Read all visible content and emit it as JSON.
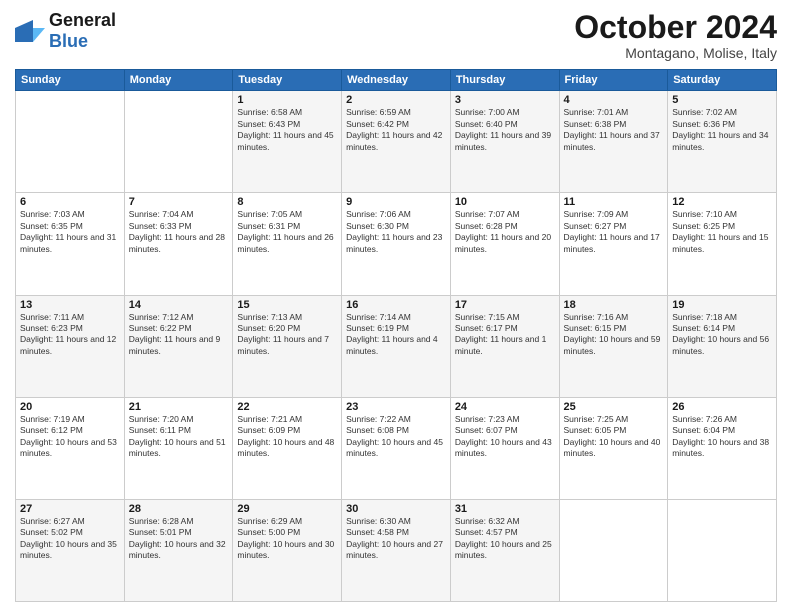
{
  "header": {
    "logo_general": "General",
    "logo_blue": "Blue",
    "month_title": "October 2024",
    "location": "Montagano, Molise, Italy"
  },
  "days_of_week": [
    "Sunday",
    "Monday",
    "Tuesday",
    "Wednesday",
    "Thursday",
    "Friday",
    "Saturday"
  ],
  "weeks": [
    [
      {
        "day": "",
        "sunrise": "",
        "sunset": "",
        "daylight": ""
      },
      {
        "day": "",
        "sunrise": "",
        "sunset": "",
        "daylight": ""
      },
      {
        "day": "1",
        "sunrise": "Sunrise: 6:58 AM",
        "sunset": "Sunset: 6:43 PM",
        "daylight": "Daylight: 11 hours and 45 minutes."
      },
      {
        "day": "2",
        "sunrise": "Sunrise: 6:59 AM",
        "sunset": "Sunset: 6:42 PM",
        "daylight": "Daylight: 11 hours and 42 minutes."
      },
      {
        "day": "3",
        "sunrise": "Sunrise: 7:00 AM",
        "sunset": "Sunset: 6:40 PM",
        "daylight": "Daylight: 11 hours and 39 minutes."
      },
      {
        "day": "4",
        "sunrise": "Sunrise: 7:01 AM",
        "sunset": "Sunset: 6:38 PM",
        "daylight": "Daylight: 11 hours and 37 minutes."
      },
      {
        "day": "5",
        "sunrise": "Sunrise: 7:02 AM",
        "sunset": "Sunset: 6:36 PM",
        "daylight": "Daylight: 11 hours and 34 minutes."
      }
    ],
    [
      {
        "day": "6",
        "sunrise": "Sunrise: 7:03 AM",
        "sunset": "Sunset: 6:35 PM",
        "daylight": "Daylight: 11 hours and 31 minutes."
      },
      {
        "day": "7",
        "sunrise": "Sunrise: 7:04 AM",
        "sunset": "Sunset: 6:33 PM",
        "daylight": "Daylight: 11 hours and 28 minutes."
      },
      {
        "day": "8",
        "sunrise": "Sunrise: 7:05 AM",
        "sunset": "Sunset: 6:31 PM",
        "daylight": "Daylight: 11 hours and 26 minutes."
      },
      {
        "day": "9",
        "sunrise": "Sunrise: 7:06 AM",
        "sunset": "Sunset: 6:30 PM",
        "daylight": "Daylight: 11 hours and 23 minutes."
      },
      {
        "day": "10",
        "sunrise": "Sunrise: 7:07 AM",
        "sunset": "Sunset: 6:28 PM",
        "daylight": "Daylight: 11 hours and 20 minutes."
      },
      {
        "day": "11",
        "sunrise": "Sunrise: 7:09 AM",
        "sunset": "Sunset: 6:27 PM",
        "daylight": "Daylight: 11 hours and 17 minutes."
      },
      {
        "day": "12",
        "sunrise": "Sunrise: 7:10 AM",
        "sunset": "Sunset: 6:25 PM",
        "daylight": "Daylight: 11 hours and 15 minutes."
      }
    ],
    [
      {
        "day": "13",
        "sunrise": "Sunrise: 7:11 AM",
        "sunset": "Sunset: 6:23 PM",
        "daylight": "Daylight: 11 hours and 12 minutes."
      },
      {
        "day": "14",
        "sunrise": "Sunrise: 7:12 AM",
        "sunset": "Sunset: 6:22 PM",
        "daylight": "Daylight: 11 hours and 9 minutes."
      },
      {
        "day": "15",
        "sunrise": "Sunrise: 7:13 AM",
        "sunset": "Sunset: 6:20 PM",
        "daylight": "Daylight: 11 hours and 7 minutes."
      },
      {
        "day": "16",
        "sunrise": "Sunrise: 7:14 AM",
        "sunset": "Sunset: 6:19 PM",
        "daylight": "Daylight: 11 hours and 4 minutes."
      },
      {
        "day": "17",
        "sunrise": "Sunrise: 7:15 AM",
        "sunset": "Sunset: 6:17 PM",
        "daylight": "Daylight: 11 hours and 1 minute."
      },
      {
        "day": "18",
        "sunrise": "Sunrise: 7:16 AM",
        "sunset": "Sunset: 6:15 PM",
        "daylight": "Daylight: 10 hours and 59 minutes."
      },
      {
        "day": "19",
        "sunrise": "Sunrise: 7:18 AM",
        "sunset": "Sunset: 6:14 PM",
        "daylight": "Daylight: 10 hours and 56 minutes."
      }
    ],
    [
      {
        "day": "20",
        "sunrise": "Sunrise: 7:19 AM",
        "sunset": "Sunset: 6:12 PM",
        "daylight": "Daylight: 10 hours and 53 minutes."
      },
      {
        "day": "21",
        "sunrise": "Sunrise: 7:20 AM",
        "sunset": "Sunset: 6:11 PM",
        "daylight": "Daylight: 10 hours and 51 minutes."
      },
      {
        "day": "22",
        "sunrise": "Sunrise: 7:21 AM",
        "sunset": "Sunset: 6:09 PM",
        "daylight": "Daylight: 10 hours and 48 minutes."
      },
      {
        "day": "23",
        "sunrise": "Sunrise: 7:22 AM",
        "sunset": "Sunset: 6:08 PM",
        "daylight": "Daylight: 10 hours and 45 minutes."
      },
      {
        "day": "24",
        "sunrise": "Sunrise: 7:23 AM",
        "sunset": "Sunset: 6:07 PM",
        "daylight": "Daylight: 10 hours and 43 minutes."
      },
      {
        "day": "25",
        "sunrise": "Sunrise: 7:25 AM",
        "sunset": "Sunset: 6:05 PM",
        "daylight": "Daylight: 10 hours and 40 minutes."
      },
      {
        "day": "26",
        "sunrise": "Sunrise: 7:26 AM",
        "sunset": "Sunset: 6:04 PM",
        "daylight": "Daylight: 10 hours and 38 minutes."
      }
    ],
    [
      {
        "day": "27",
        "sunrise": "Sunrise: 6:27 AM",
        "sunset": "Sunset: 5:02 PM",
        "daylight": "Daylight: 10 hours and 35 minutes."
      },
      {
        "day": "28",
        "sunrise": "Sunrise: 6:28 AM",
        "sunset": "Sunset: 5:01 PM",
        "daylight": "Daylight: 10 hours and 32 minutes."
      },
      {
        "day": "29",
        "sunrise": "Sunrise: 6:29 AM",
        "sunset": "Sunset: 5:00 PM",
        "daylight": "Daylight: 10 hours and 30 minutes."
      },
      {
        "day": "30",
        "sunrise": "Sunrise: 6:30 AM",
        "sunset": "Sunset: 4:58 PM",
        "daylight": "Daylight: 10 hours and 27 minutes."
      },
      {
        "day": "31",
        "sunrise": "Sunrise: 6:32 AM",
        "sunset": "Sunset: 4:57 PM",
        "daylight": "Daylight: 10 hours and 25 minutes."
      },
      {
        "day": "",
        "sunrise": "",
        "sunset": "",
        "daylight": ""
      },
      {
        "day": "",
        "sunrise": "",
        "sunset": "",
        "daylight": ""
      }
    ]
  ]
}
